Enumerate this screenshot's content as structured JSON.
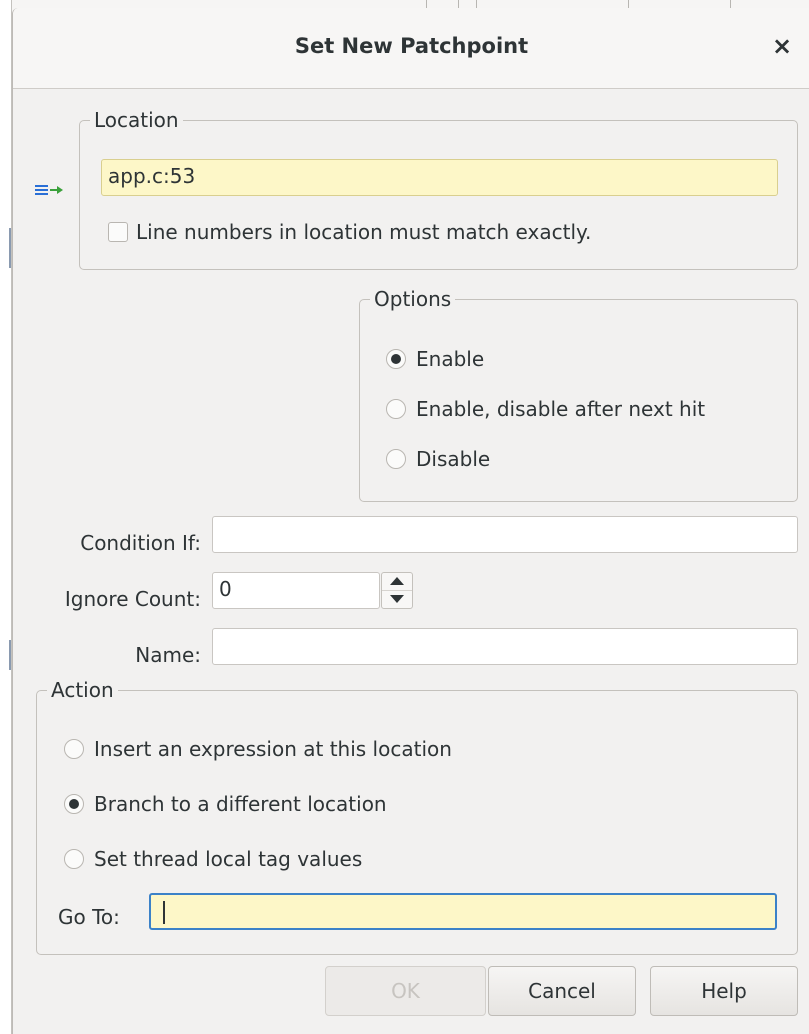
{
  "dialog": {
    "title": "Set New Patchpoint",
    "close_glyph": "×"
  },
  "location": {
    "legend": "Location",
    "value": "app.c:53",
    "exact_match_label": "Line numbers in location must match exactly.",
    "exact_match_checked": false,
    "icon": "location-arrow-icon"
  },
  "options": {
    "legend": "Options",
    "items": [
      {
        "label": "Enable",
        "selected": true
      },
      {
        "label": "Enable, disable after next hit",
        "selected": false
      },
      {
        "label": "Disable",
        "selected": false
      }
    ]
  },
  "fields": {
    "condition_label": "Condition If:",
    "condition_value": "",
    "ignore_count_label": "Ignore Count:",
    "ignore_count_value": "0",
    "name_label": "Name:",
    "name_value": ""
  },
  "action": {
    "legend": "Action",
    "items": [
      {
        "label": "Insert an expression at this location",
        "selected": false
      },
      {
        "label": "Branch to a different location",
        "selected": true
      },
      {
        "label": "Set thread local tag values",
        "selected": false
      }
    ],
    "goto_label": "Go To:",
    "goto_value": ""
  },
  "buttons": {
    "ok": "OK",
    "ok_enabled": false,
    "cancel": "Cancel",
    "help": "Help"
  },
  "colors": {
    "highlight_field": "#fdf7c8",
    "focus_border": "#3c82c8",
    "icon_blue": "#2a6fd6",
    "icon_green": "#3aa03a"
  }
}
